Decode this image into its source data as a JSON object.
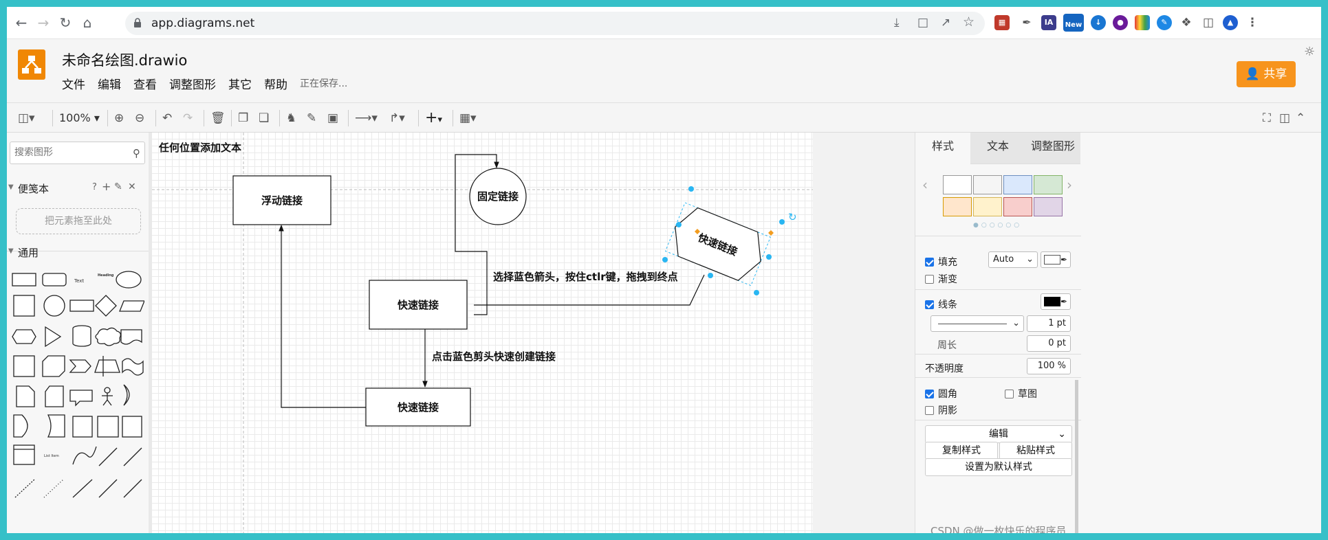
{
  "browser": {
    "url": "app.diagrams.net",
    "badge_new": "New",
    "ext_ia": "IA"
  },
  "app": {
    "doc_title": "未命名绘图.drawio",
    "menu": [
      "文件",
      "编辑",
      "查看",
      "调整图形",
      "其它",
      "帮助"
    ],
    "saving_status": "正在保存...",
    "share_label": "共享"
  },
  "toolbar": {
    "zoom": "100%"
  },
  "sidebar": {
    "search_placeholder": "搜索图形",
    "scratchpad_title": "便笺本",
    "scratchpad_actions": [
      "?",
      "+",
      "✎",
      "✕"
    ],
    "dropzone_text": "把元素拖至此处",
    "general_title": "通用",
    "shape_labels": {
      "text": "Text",
      "heading": "Heading",
      "list_item": "List Item"
    }
  },
  "diagram": {
    "title_text": "任何位置添加文本",
    "node_floating": "浮动链接",
    "node_fixed": "固定链接",
    "node_quick_1": "快速链接",
    "node_quick_2": "快速链接",
    "node_selected": "快速链接",
    "annotation_ctrl": "选择蓝色箭头，按住ctlr键，拖拽到终点",
    "annotation_click": "点击蓝色剪头快速创建链接"
  },
  "format_panel": {
    "tabs": [
      "样式",
      "文本",
      "调整图形"
    ],
    "swatch_colors": [
      "#ffffff",
      "#f5f5f5",
      "#dae8fc",
      "#d5e8d4",
      "#ffe6cc",
      "#fff2cc",
      "#f8cecc",
      "#e1d5e7"
    ],
    "fill_label": "填充",
    "fill_value": "Auto",
    "gradient_label": "渐变",
    "line_label": "线条",
    "line_width": "1 pt",
    "perimeter_label": "周长",
    "perimeter_value": "0 pt",
    "opacity_label": "不透明度",
    "opacity_value": "100 %",
    "rounded_label": "圆角",
    "sketch_label": "草图",
    "shadow_label": "阴影",
    "edit_label": "编辑",
    "copy_style_label": "复制样式",
    "paste_style_label": "粘贴样式",
    "set_default_label": "设置为默认样式"
  },
  "watermark": "CSDN @做一枚快乐的程序员",
  "colors": {
    "brand_orange": "#f08705",
    "share_orange": "#f7941d",
    "selection_blue": "#29b6f2",
    "handle_orange": "#f29c1f"
  }
}
